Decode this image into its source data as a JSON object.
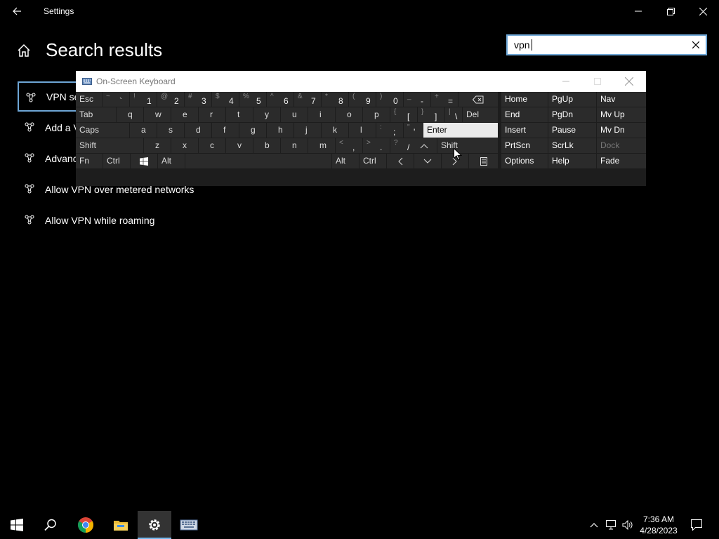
{
  "window": {
    "title": "Settings"
  },
  "page": {
    "title": "Search results"
  },
  "search": {
    "value": "vpn"
  },
  "results": [
    {
      "label": "VPN se",
      "selected": true
    },
    {
      "label": "Add a V"
    },
    {
      "label": "Advanc"
    },
    {
      "label": "Allow VPN over metered networks"
    },
    {
      "label": "Allow VPN while roaming"
    }
  ],
  "osk": {
    "title": "On-Screen Keyboard",
    "rows": [
      [
        {
          "label": "Esc"
        },
        {
          "shift": "~",
          "main": "`"
        },
        {
          "shift": "!",
          "main": "1"
        },
        {
          "shift": "@",
          "main": "2"
        },
        {
          "shift": "#",
          "main": "3"
        },
        {
          "shift": "$",
          "main": "4"
        },
        {
          "shift": "%",
          "main": "5"
        },
        {
          "shift": "^",
          "main": "6"
        },
        {
          "shift": "&",
          "main": "7"
        },
        {
          "shift": "*",
          "main": "8"
        },
        {
          "shift": "(",
          "main": "9"
        },
        {
          "shift": ")",
          "main": "0"
        },
        {
          "shift": "_",
          "main": "-"
        },
        {
          "shift": "+",
          "main": "="
        },
        {
          "icon": "backspace"
        }
      ],
      [
        {
          "label": "Tab"
        },
        {
          "label": "q"
        },
        {
          "label": "w"
        },
        {
          "label": "e"
        },
        {
          "label": "r"
        },
        {
          "label": "t"
        },
        {
          "label": "y"
        },
        {
          "label": "u"
        },
        {
          "label": "i"
        },
        {
          "label": "o"
        },
        {
          "label": "p"
        },
        {
          "shift": "{",
          "main": "["
        },
        {
          "shift": "}",
          "main": "]"
        },
        {
          "shift": "|",
          "main": "\\"
        },
        {
          "label": "Del"
        }
      ],
      [
        {
          "label": "Caps"
        },
        {
          "label": "a"
        },
        {
          "label": "s"
        },
        {
          "label": "d"
        },
        {
          "label": "f"
        },
        {
          "label": "g"
        },
        {
          "label": "h"
        },
        {
          "label": "j"
        },
        {
          "label": "k"
        },
        {
          "label": "l"
        },
        {
          "shift": ":",
          "main": ";"
        },
        {
          "shift": "\"",
          "main": "'"
        },
        {
          "label": "Enter"
        }
      ],
      [
        {
          "label": "Shift"
        },
        {
          "label": "z"
        },
        {
          "label": "x"
        },
        {
          "label": "c"
        },
        {
          "label": "v"
        },
        {
          "label": "b"
        },
        {
          "label": "n"
        },
        {
          "label": "m"
        },
        {
          "shift": "<",
          "main": ","
        },
        {
          "shift": ">",
          "main": "."
        },
        {
          "shift": "?",
          "main": "/"
        },
        {
          "icon": "up"
        },
        {
          "label": "Shift"
        }
      ],
      [
        {
          "label": "Fn"
        },
        {
          "label": "Ctrl"
        },
        {
          "icon": "windows"
        },
        {
          "label": "Alt"
        },
        {
          "label": ""
        },
        {
          "label": "Alt"
        },
        {
          "label": "Ctrl"
        },
        {
          "icon": "left"
        },
        {
          "icon": "down"
        },
        {
          "icon": "right"
        },
        {
          "icon": "menu"
        }
      ]
    ],
    "nav_keys": [
      [
        "Home",
        "PgUp",
        "Nav"
      ],
      [
        "End",
        "PgDn",
        "Mv Up"
      ],
      [
        "Insert",
        "Pause",
        "Mv Dn"
      ],
      [
        "PrtScn",
        "ScrLk",
        "Dock"
      ],
      [
        "Options",
        "Help",
        "Fade"
      ]
    ]
  },
  "taskbar": {
    "apps": [
      "start-icon",
      "search-icon",
      "chrome-icon",
      "file-explorer-icon",
      "settings-icon",
      "osk-app-icon"
    ],
    "time": "7:36 AM",
    "date": "4/28/2023"
  },
  "colors": {
    "accent": "#6ea6d6",
    "key": "#2b2b2b",
    "key_highlight": "#eaeaea",
    "taskbar_active": "#76b9ed"
  }
}
